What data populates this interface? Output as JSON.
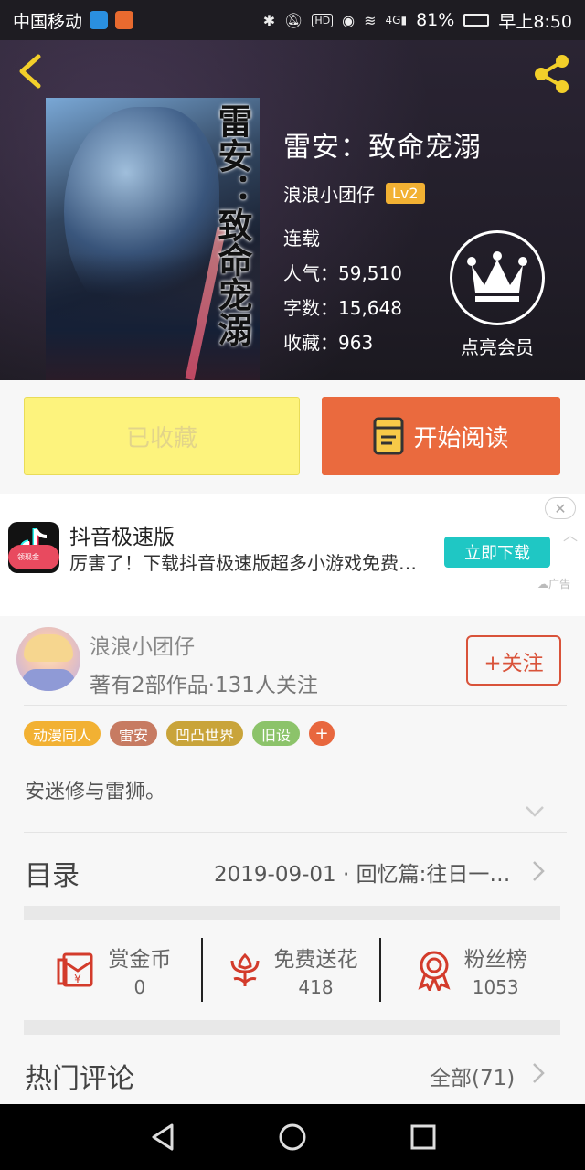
{
  "status_bar": {
    "carrier": "中国移动",
    "battery": "81%",
    "time": "早上8:50",
    "network": "4G",
    "icons": [
      "bluetooth-icon",
      "mute-icon",
      "hd-icon",
      "eye-icon",
      "wifi-icon",
      "signal-icon",
      "battery-icon"
    ]
  },
  "book": {
    "title": "雷安：致命宠溺",
    "cover_text": "雷安：致命宠溺",
    "author": "浪浪小团仔",
    "level": "Lv2",
    "status": "连载",
    "popularity": "人气：59,510",
    "word_count": "字数：15,648",
    "favorites": "收藏：963",
    "vip_label": "点亮会员"
  },
  "actions": {
    "favorited_label": "已收藏",
    "read_label": "开始阅读"
  },
  "ad": {
    "app_name": "抖音极速版",
    "icon_tag": "领现金",
    "description": "厉害了！下载抖音极速版超多小游戏免费…",
    "cta": "立即下载",
    "mark": "广告",
    "close": "✕"
  },
  "author_card": {
    "name": "浪浪小团仔",
    "stats": "著有2部作品·131人关注",
    "follow_label": "+关注"
  },
  "tags": [
    {
      "label": "动漫同人",
      "color": "#f2b133"
    },
    {
      "label": "雷安",
      "color": "#c77b62"
    },
    {
      "label": "凹凸世界",
      "color": "#c9a43a"
    },
    {
      "label": "旧设",
      "color": "#8cc36a"
    }
  ],
  "tag_more": "+",
  "intro": "安迷修与雷狮。",
  "toc": {
    "label": "目录",
    "latest": "2019-09-01 · 回忆篇:往日一…"
  },
  "stats": [
    {
      "label": "赏金币",
      "value": "0",
      "icon": "red-envelope-icon"
    },
    {
      "label": "免费送花",
      "value": "418",
      "icon": "flower-icon"
    },
    {
      "label": "粉丝榜",
      "value": "1053",
      "icon": "medal-icon"
    }
  ],
  "comments": {
    "label": "热门评论",
    "all": "全部(71)"
  },
  "colors": {
    "accent": "#ea6a3e",
    "favorited_bg": "#fdf37d",
    "follow": "#d9533a",
    "level_badge": "#f2b133",
    "ad_button": "#1fc7c4"
  }
}
